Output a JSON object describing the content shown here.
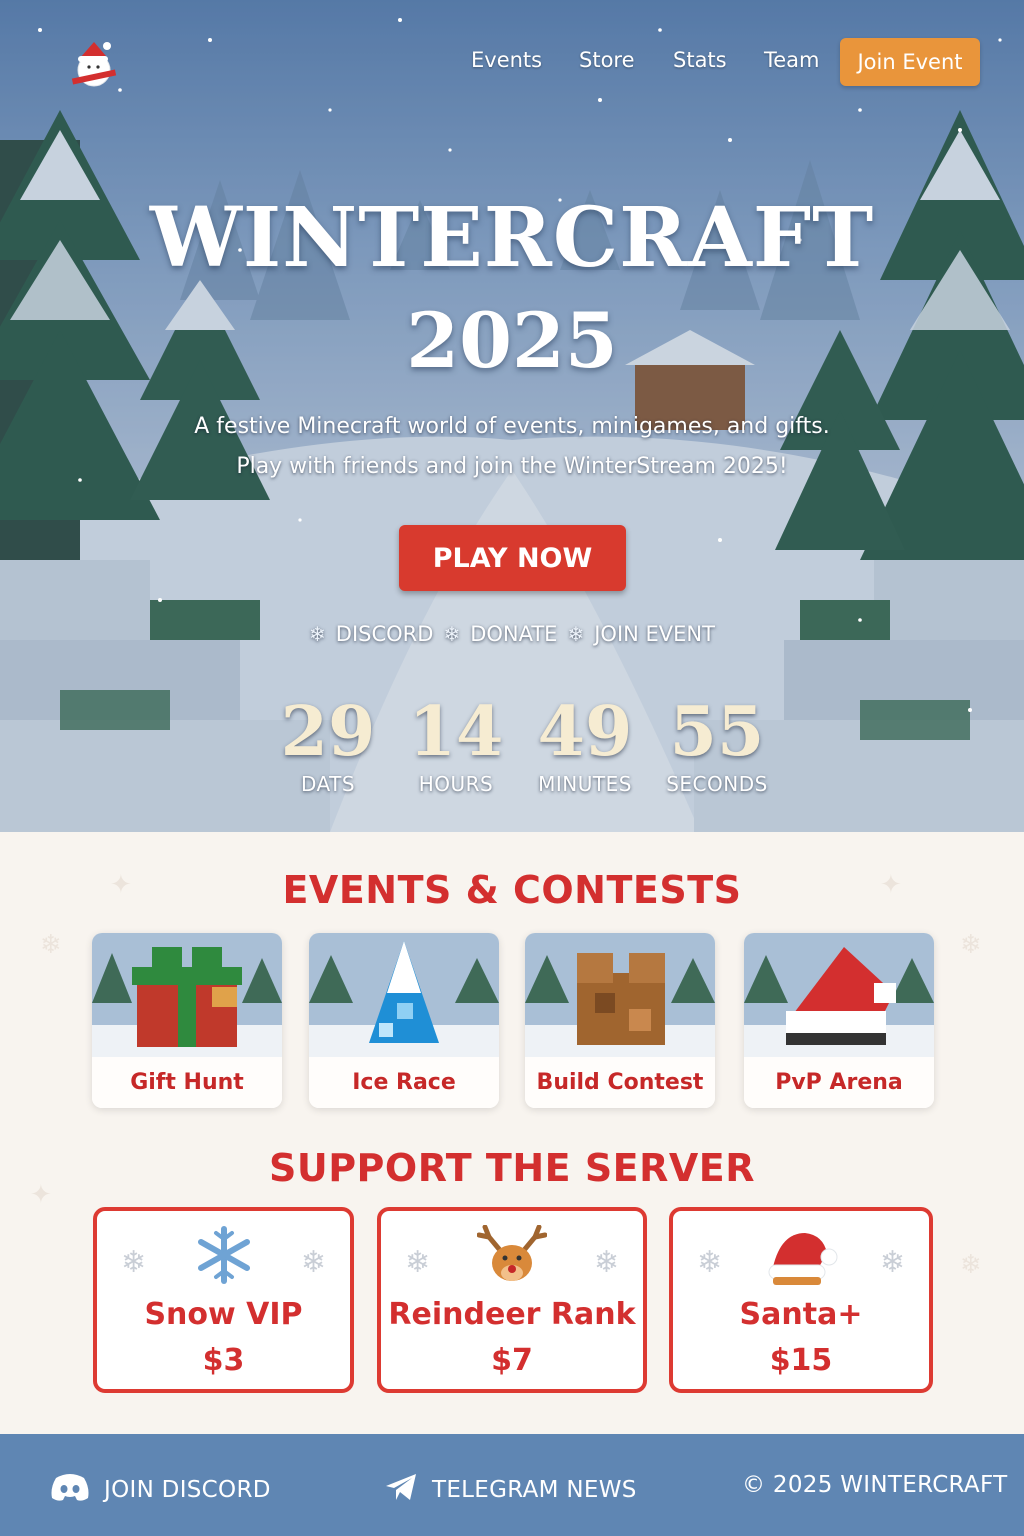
{
  "nav": {
    "links": [
      "Events",
      "Store",
      "Stats",
      "Team"
    ],
    "cta": "Join Event",
    "logo_icon": "santa-snowman-logo-icon"
  },
  "hero": {
    "title_line1": "WINTERCRAFT",
    "title_line2": "2025",
    "subtitle_line1": "A festive Minecraft world of events, minigames, and gifts.",
    "subtitle_line2": "Play with friends and join the WinterStream 2025!",
    "play_button": "PLAY NOW",
    "quick_links": [
      "DISCORD",
      "DONATE",
      "JOIN EVENT"
    ],
    "countdown": [
      {
        "value": "29",
        "label": "DATS"
      },
      {
        "value": "14",
        "label": "HOURS"
      },
      {
        "value": "49",
        "label": "MINUTES"
      },
      {
        "value": "55",
        "label": "SECONDS"
      }
    ]
  },
  "events": {
    "title": "EVENTS & CONTESTS",
    "items": [
      {
        "label": "Gift Hunt",
        "icon": "gift-icon"
      },
      {
        "label": "Ice Race",
        "icon": "ice-icon"
      },
      {
        "label": "Build Contest",
        "icon": "wood-block-icon"
      },
      {
        "label": "PvP Arena",
        "icon": "santa-hat-icon"
      }
    ]
  },
  "support": {
    "title": "SUPPORT THE SERVER",
    "tiers": [
      {
        "name": "Snow VIP",
        "price": "$3",
        "icon": "snowflake-icon"
      },
      {
        "name": "Reindeer Rank",
        "price": "$7",
        "icon": "reindeer-icon"
      },
      {
        "name": "Santa+",
        "price": "$15",
        "icon": "santa-hat-icon"
      }
    ]
  },
  "footer": {
    "discord": "JOIN DISCORD",
    "telegram": "TELEGRAM NEWS",
    "copyright": "© 2025 WINTERCRAFT"
  },
  "colors": {
    "accent_red": "#d32f2f",
    "cta_orange": "#e9953b",
    "footer_blue": "#5f86b3",
    "countdown_cream": "#f6ecd2"
  }
}
